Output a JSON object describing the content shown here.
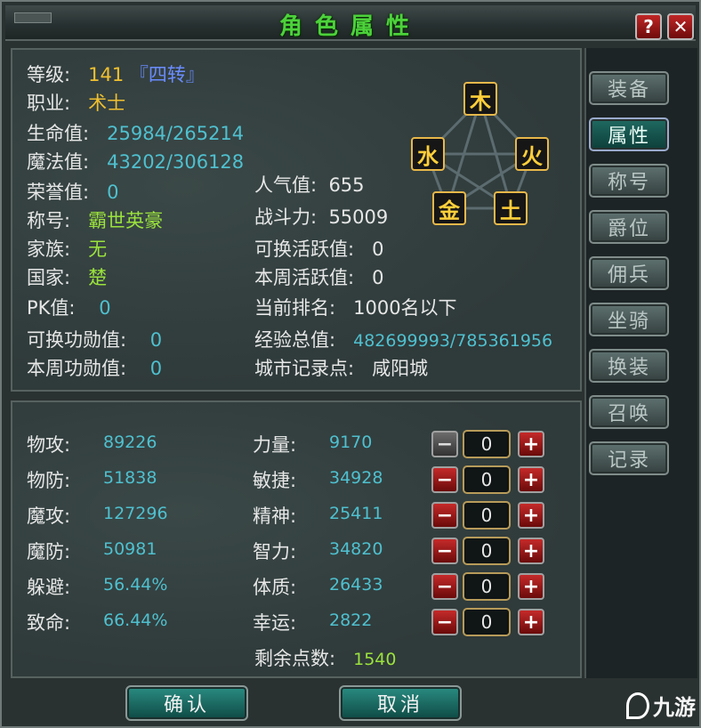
{
  "window": {
    "title": "角色属性",
    "help_label": "?",
    "close_label": "✕"
  },
  "info": {
    "level_label": "等级:",
    "level_value": "141",
    "level_tag": "『四转』",
    "job_label": "职业:",
    "job_value": "术士",
    "hp_label": "生命值:",
    "hp_value": "25984/265214",
    "mp_label": "魔法值:",
    "mp_value": "43202/306128",
    "honor_label": "荣誉值:",
    "honor_value": "0",
    "title_label": "称号:",
    "title_value": "霸世英豪",
    "family_label": "家族:",
    "family_value": "无",
    "country_label": "国家:",
    "country_value": "楚",
    "pk_label": "PK值:",
    "pk_value": "0",
    "merit_ex_label": "可换功勋值:",
    "merit_ex_value": "0",
    "merit_week_label": "本周功勋值:",
    "merit_week_value": "0",
    "popularity_label": "人气值:",
    "popularity_value": "655",
    "power_label": "战斗力:",
    "power_value": "55009",
    "active_ex_label": "可换活跃值:",
    "active_ex_value": "0",
    "active_week_label": "本周活跃值:",
    "active_week_value": "0",
    "rank_label": "当前排名:",
    "rank_value": "1000名以下",
    "exp_label": "经验总值:",
    "exp_value": "482699993/785361956",
    "city_label": "城市记录点:",
    "city_value": "咸阳城"
  },
  "elements": {
    "wood": "木",
    "fire": "火",
    "earth": "土",
    "metal": "金",
    "water": "水"
  },
  "combat": [
    {
      "label": "物攻:",
      "value": "89226"
    },
    {
      "label": "物防:",
      "value": "51838"
    },
    {
      "label": "魔攻:",
      "value": "127296"
    },
    {
      "label": "魔防:",
      "value": "50981"
    },
    {
      "label": "躲避:",
      "value": "56.44%"
    },
    {
      "label": "致命:",
      "value": "66.44%"
    }
  ],
  "attributes": [
    {
      "label": "力量:",
      "value": "9170",
      "alloc": "0"
    },
    {
      "label": "敏捷:",
      "value": "34928",
      "alloc": "0"
    },
    {
      "label": "精神:",
      "value": "25411",
      "alloc": "0"
    },
    {
      "label": "智力:",
      "value": "34820",
      "alloc": "0"
    },
    {
      "label": "体质:",
      "value": "26433",
      "alloc": "0"
    },
    {
      "label": "幸运:",
      "value": "2822",
      "alloc": "0"
    }
  ],
  "stepper_minus": "−",
  "stepper_plus": "+",
  "remaining": {
    "label": "剩余点数:",
    "value": "1540"
  },
  "tabs": [
    "装备",
    "属性",
    "称号",
    "爵位",
    "佣兵",
    "坐骑",
    "换装",
    "召唤",
    "记录"
  ],
  "buttons": {
    "confirm": "确认",
    "cancel": "取消"
  },
  "watermark": "九游",
  "colors": {
    "label": "#e6e6e6",
    "value_cyan": "#4fc0cf",
    "value_orange": "#f0c030",
    "value_green": "#9be23d",
    "title_green": "#4cd23a"
  }
}
